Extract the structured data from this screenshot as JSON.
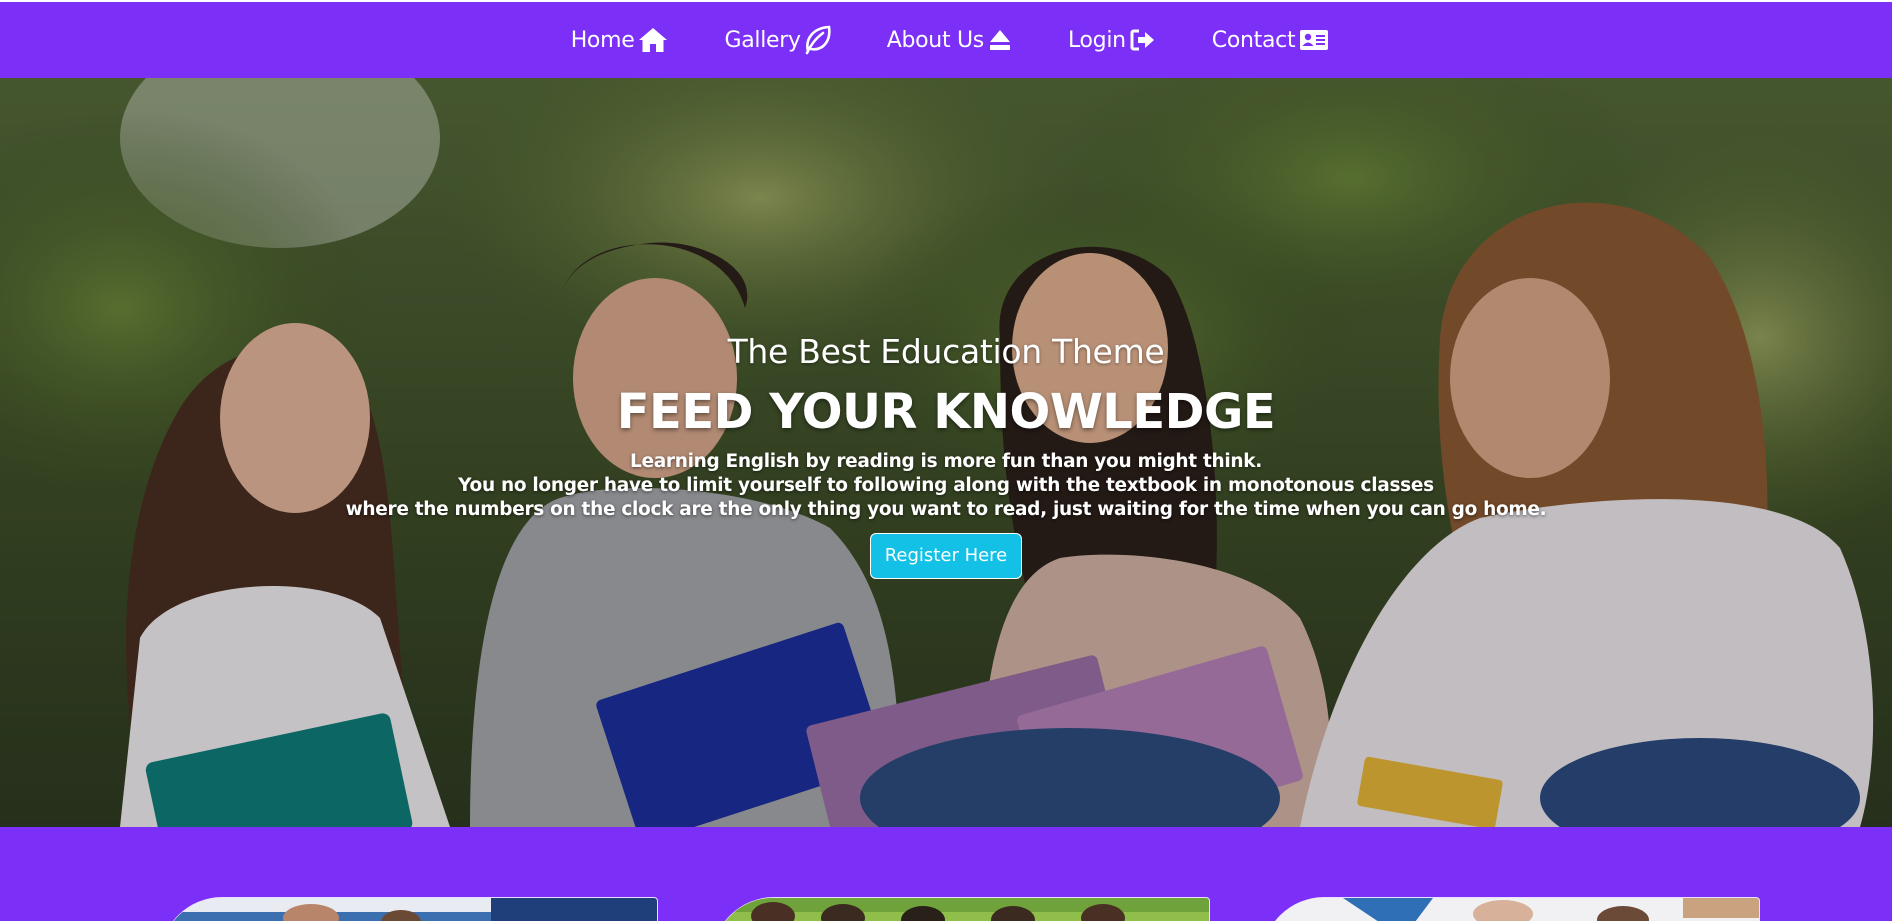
{
  "nav": {
    "items": [
      {
        "label": "Home",
        "icon": "home-icon"
      },
      {
        "label": "Gallery",
        "icon": "leaf-icon"
      },
      {
        "label": "About Us",
        "icon": "eject-icon"
      },
      {
        "label": "Login",
        "icon": "sign-in-icon"
      },
      {
        "label": "Contact",
        "icon": "address-card-icon"
      }
    ]
  },
  "hero": {
    "subtitle": "The Best Education Theme",
    "title": "FEED YOUR KNOWLEDGE",
    "lines": [
      "Learning English by reading is more fun than you might think.",
      "You no longer have to limit yourself to following along with the textbook in monotonous classes",
      "where the numbers on the clock are the only thing you want to read, just waiting for the time when you can go home."
    ],
    "button_label": "Register Here"
  },
  "colors": {
    "brand": "#7b2ff7",
    "button": "#13c1e6",
    "text": "#ffffff"
  }
}
